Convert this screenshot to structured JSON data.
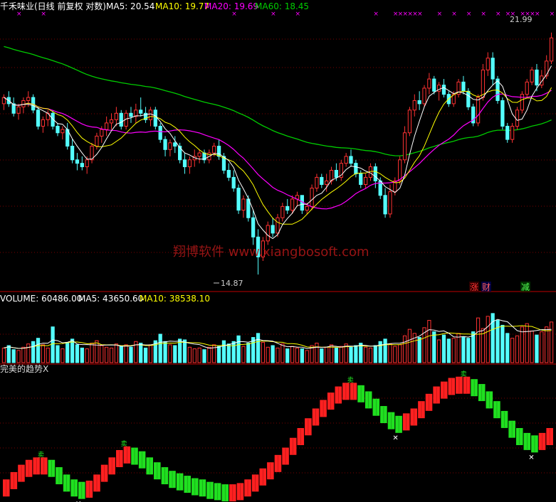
{
  "colors": {
    "background": "#000000",
    "grid": "#7a0000",
    "up": "#ff3232",
    "down": "#54ffff",
    "ma5": "#ffffff",
    "ma10": "#ffff00",
    "ma20": "#ff00ff",
    "ma60": "#00cc00",
    "trend_up": "#ff2020",
    "trend_down": "#20e020",
    "marker": "#ff00ff",
    "watermark": "#b01818"
  },
  "header": {
    "title": "千禾味业(日线 前复权 对数)",
    "ma5": "MA5: 20.54",
    "ma10": "MA10: 19.77",
    "ma20": "MA20: 19.69",
    "ma60": "MA60: 18.45"
  },
  "watermark": "翔博软件 www.xiangbosoft.com",
  "annotations": {
    "high": "21.99",
    "low": "14.87"
  },
  "badges": [
    {
      "text": "涨",
      "color": "#ff3232"
    },
    {
      "text": "财",
      "color": "#ff3232"
    },
    {
      "text": "减",
      "color": "#54ff54"
    }
  ],
  "volume_header": {
    "volume": "VOLUME: 60486.00",
    "ma5": "MA5: 43650.60",
    "ma10": "MA10: 38538.10"
  },
  "indicator_header": {
    "name": "完美的趋势X"
  },
  "chart_data": {
    "type": "candlestick",
    "price": {
      "ylim": [
        14.5,
        22.6
      ],
      "candles": [
        [
          19.6,
          19.9,
          19.4,
          19.8
        ],
        [
          19.8,
          20.0,
          19.5,
          19.6
        ],
        [
          19.6,
          19.8,
          19.2,
          19.3
        ],
        [
          19.3,
          19.6,
          19.1,
          19.5
        ],
        [
          19.5,
          19.8,
          19.3,
          19.7
        ],
        [
          19.7,
          20.0,
          19.5,
          19.8
        ],
        [
          19.8,
          19.9,
          19.3,
          19.4
        ],
        [
          19.4,
          19.5,
          18.8,
          18.9
        ],
        [
          18.9,
          19.2,
          18.7,
          19.1
        ],
        [
          19.1,
          19.4,
          18.9,
          19.3
        ],
        [
          19.3,
          19.4,
          18.8,
          18.9
        ],
        [
          18.9,
          19.0,
          18.6,
          18.7
        ],
        [
          18.7,
          18.9,
          18.5,
          18.8
        ],
        [
          18.8,
          19.0,
          18.2,
          18.3
        ],
        [
          18.3,
          18.5,
          17.8,
          17.9
        ],
        [
          17.9,
          18.1,
          17.6,
          17.8
        ],
        [
          17.8,
          18.0,
          17.6,
          17.7
        ],
        [
          17.7,
          18.0,
          17.5,
          17.9
        ],
        [
          17.9,
          18.4,
          17.8,
          18.3
        ],
        [
          18.3,
          18.7,
          18.2,
          18.6
        ],
        [
          18.6,
          18.9,
          18.4,
          18.8
        ],
        [
          18.8,
          19.2,
          18.6,
          19.0
        ],
        [
          19.0,
          19.3,
          18.8,
          19.1
        ],
        [
          19.1,
          19.5,
          18.9,
          19.3
        ],
        [
          19.3,
          19.4,
          18.8,
          18.9
        ],
        [
          18.9,
          19.4,
          18.8,
          19.3
        ],
        [
          19.3,
          19.5,
          19.0,
          19.2
        ],
        [
          19.2,
          19.6,
          19.0,
          19.4
        ],
        [
          19.4,
          19.8,
          19.2,
          19.3
        ],
        [
          19.3,
          19.5,
          19.0,
          19.1
        ],
        [
          19.1,
          19.5,
          18.9,
          19.4
        ],
        [
          19.4,
          19.5,
          18.8,
          18.9
        ],
        [
          18.9,
          19.0,
          18.4,
          18.5
        ],
        [
          18.5,
          18.6,
          18.0,
          18.2
        ],
        [
          18.2,
          18.5,
          18.0,
          18.4
        ],
        [
          18.4,
          18.6,
          18.1,
          18.3
        ],
        [
          18.3,
          18.4,
          17.8,
          17.9
        ],
        [
          17.9,
          18.1,
          17.5,
          17.7
        ],
        [
          17.7,
          18.0,
          17.5,
          17.9
        ],
        [
          17.9,
          18.2,
          17.7,
          18.0
        ],
        [
          18.0,
          18.2,
          17.8,
          18.1
        ],
        [
          18.1,
          18.2,
          17.8,
          17.9
        ],
        [
          17.9,
          18.2,
          17.8,
          18.1
        ],
        [
          18.1,
          18.4,
          18.0,
          18.3
        ],
        [
          18.3,
          18.5,
          17.9,
          18.0
        ],
        [
          18.0,
          18.1,
          17.5,
          17.6
        ],
        [
          17.6,
          17.8,
          17.3,
          17.4
        ],
        [
          17.4,
          17.6,
          17.0,
          17.1
        ],
        [
          17.1,
          17.2,
          16.4,
          16.5
        ],
        [
          16.5,
          16.9,
          16.3,
          16.8
        ],
        [
          16.8,
          16.9,
          16.2,
          16.3
        ],
        [
          16.3,
          16.5,
          15.6,
          15.8
        ],
        [
          15.8,
          16.0,
          14.87,
          15.3
        ],
        [
          15.3,
          15.8,
          15.2,
          15.7
        ],
        [
          15.7,
          16.2,
          15.6,
          16.1
        ],
        [
          16.1,
          16.3,
          15.8,
          15.9
        ],
        [
          15.9,
          16.4,
          15.8,
          16.3
        ],
        [
          16.3,
          16.7,
          16.2,
          16.6
        ],
        [
          16.6,
          16.8,
          16.4,
          16.5
        ],
        [
          16.5,
          16.9,
          16.4,
          16.8
        ],
        [
          16.8,
          17.0,
          16.6,
          16.9
        ],
        [
          16.9,
          16.9,
          16.4,
          16.5
        ],
        [
          16.5,
          16.7,
          16.4,
          16.6
        ],
        [
          16.6,
          17.2,
          16.5,
          17.1
        ],
        [
          17.1,
          17.5,
          17.0,
          17.4
        ],
        [
          17.4,
          17.5,
          17.1,
          17.2
        ],
        [
          17.2,
          17.5,
          17.0,
          17.3
        ],
        [
          17.3,
          17.7,
          17.2,
          17.6
        ],
        [
          17.6,
          17.8,
          17.3,
          17.4
        ],
        [
          17.4,
          17.9,
          17.3,
          17.8
        ],
        [
          17.8,
          18.1,
          17.7,
          18.0
        ],
        [
          18.0,
          18.2,
          17.7,
          17.8
        ],
        [
          17.8,
          17.9,
          17.4,
          17.5
        ],
        [
          17.5,
          17.6,
          17.1,
          17.2
        ],
        [
          17.2,
          17.5,
          17.1,
          17.4
        ],
        [
          17.4,
          17.8,
          17.3,
          17.7
        ],
        [
          17.7,
          17.8,
          17.1,
          17.3
        ],
        [
          17.3,
          17.4,
          16.8,
          16.9
        ],
        [
          16.9,
          17.1,
          16.3,
          16.4
        ],
        [
          16.4,
          17.2,
          16.3,
          17.0
        ],
        [
          17.0,
          17.4,
          16.9,
          17.3
        ],
        [
          17.3,
          18.0,
          17.2,
          17.9
        ],
        [
          17.9,
          18.9,
          17.8,
          18.7
        ],
        [
          18.7,
          19.5,
          18.6,
          19.4
        ],
        [
          19.4,
          19.9,
          19.2,
          19.7
        ],
        [
          19.7,
          20.0,
          19.4,
          19.6
        ],
        [
          19.6,
          20.2,
          19.5,
          20.1
        ],
        [
          20.1,
          20.6,
          19.9,
          20.4
        ],
        [
          20.4,
          20.5,
          19.9,
          20.0
        ],
        [
          20.0,
          20.3,
          19.7,
          20.2
        ],
        [
          20.2,
          20.4,
          19.8,
          19.9
        ],
        [
          19.9,
          20.0,
          19.5,
          19.6
        ],
        [
          19.6,
          20.0,
          19.5,
          19.9
        ],
        [
          19.9,
          20.4,
          19.8,
          20.3
        ],
        [
          20.3,
          20.5,
          19.9,
          20.0
        ],
        [
          20.0,
          20.1,
          19.4,
          19.5
        ],
        [
          19.5,
          19.6,
          18.9,
          19.0
        ],
        [
          19.0,
          19.9,
          18.9,
          19.8
        ],
        [
          19.8,
          20.9,
          19.7,
          20.7
        ],
        [
          20.7,
          21.3,
          20.5,
          21.1
        ],
        [
          21.1,
          21.3,
          20.2,
          20.4
        ],
        [
          20.4,
          20.5,
          19.6,
          19.7
        ],
        [
          19.7,
          19.8,
          18.8,
          18.9
        ],
        [
          18.9,
          19.0,
          18.4,
          18.5
        ],
        [
          18.5,
          19.0,
          18.4,
          18.9
        ],
        [
          18.9,
          19.5,
          18.8,
          19.4
        ],
        [
          19.4,
          20.0,
          19.3,
          19.9
        ],
        [
          19.9,
          20.4,
          19.8,
          20.3
        ],
        [
          20.3,
          20.8,
          20.2,
          20.7
        ],
        [
          20.7,
          20.9,
          20.0,
          20.2
        ],
        [
          20.2,
          20.7,
          20.1,
          20.5
        ],
        [
          20.5,
          21.2,
          20.4,
          21.0
        ],
        [
          21.0,
          21.99,
          20.9,
          21.8
        ]
      ]
    },
    "volume": {
      "ylim": [
        0,
        70000
      ],
      "values": [
        18000,
        21000,
        16000,
        15000,
        19000,
        23000,
        26000,
        30000,
        22000,
        18000,
        44000,
        21000,
        17000,
        25000,
        29000,
        22000,
        18000,
        17000,
        24000,
        27000,
        21000,
        19000,
        18000,
        23000,
        20000,
        22000,
        19000,
        26000,
        24000,
        18000,
        22000,
        27000,
        35000,
        26000,
        22000,
        21000,
        29000,
        28000,
        19000,
        17000,
        18000,
        16000,
        19000,
        22000,
        20000,
        27000,
        23000,
        26000,
        33000,
        20000,
        24000,
        31000,
        36000,
        25000,
        19000,
        21000,
        18000,
        23000,
        17000,
        20000,
        18000,
        17000,
        15000,
        21000,
        24000,
        17000,
        19000,
        22000,
        18000,
        20000,
        23000,
        19000,
        21000,
        24000,
        19000,
        18000,
        21000,
        26000,
        29000,
        23000,
        20000,
        22000,
        33000,
        41000,
        36000,
        31000,
        43000,
        52000,
        38000,
        28000,
        34000,
        29000,
        30000,
        36000,
        32000,
        30000,
        38000,
        55000,
        42000,
        57000,
        60486,
        52000,
        46000,
        36000,
        30000,
        33000,
        44000,
        48000,
        39000,
        34000,
        38000,
        44000,
        50000
      ]
    },
    "trend": {
      "ylim": [
        0,
        100
      ],
      "values": [
        8,
        14,
        20,
        24,
        26,
        26,
        24,
        18,
        12,
        8,
        6,
        7,
        12,
        20,
        26,
        32,
        35,
        34,
        31,
        26,
        22,
        18,
        15,
        13,
        11,
        9,
        8,
        6,
        5,
        4,
        4,
        5,
        8,
        12,
        17,
        22,
        28,
        34,
        42,
        50,
        58,
        66,
        73,
        79,
        84,
        87,
        87,
        85,
        80,
        74,
        68,
        63,
        60,
        62,
        66,
        72,
        78,
        84,
        88,
        91,
        92,
        92,
        90,
        86,
        80,
        72,
        64,
        56,
        50,
        46,
        44,
        46,
        50
      ]
    }
  }
}
